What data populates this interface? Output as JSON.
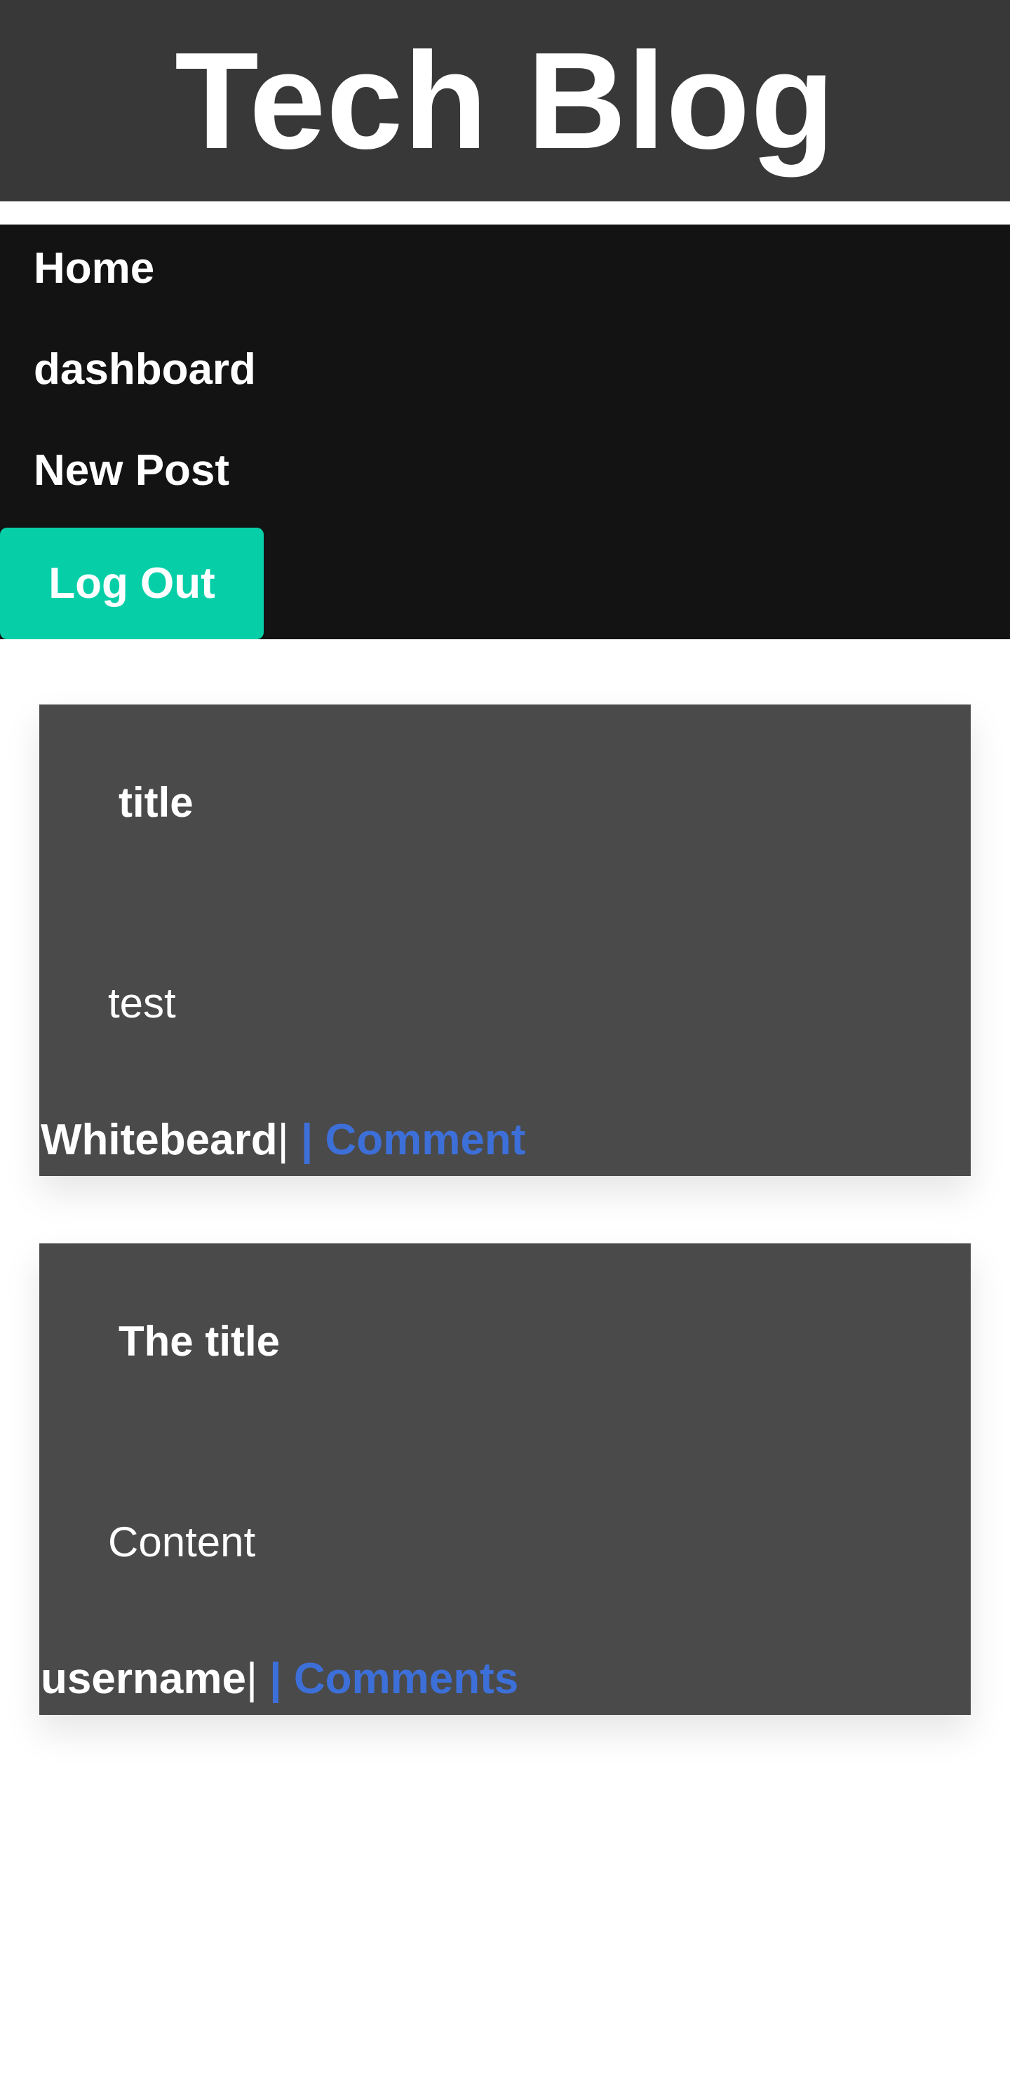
{
  "header": {
    "title": "Tech Blog"
  },
  "nav": {
    "home": "Home",
    "dashboard": "dashboard",
    "new_post": "New Post",
    "logout": "Log Out"
  },
  "posts": [
    {
      "title": "title",
      "content": "test",
      "author": "Whitebeard",
      "separator": "|",
      "comment_link": " | Comment"
    },
    {
      "title": "The title",
      "content": "Content",
      "author": "username",
      "separator": "|",
      "comment_link": " | Comments"
    }
  ],
  "colors": {
    "header_bg": "#383838",
    "nav_bg": "#131313",
    "logout_bg": "#06cfa8",
    "card_bg": "#4a4a4a",
    "link": "#3d6fd8"
  }
}
